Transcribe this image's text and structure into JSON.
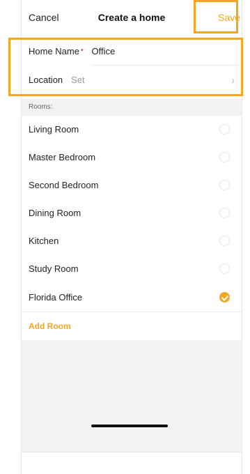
{
  "navbar": {
    "cancel": "Cancel",
    "title": "Create a home",
    "save": "Save"
  },
  "form": {
    "home_name_label": "Home Name",
    "required_mark": "•",
    "home_name_value": "Office",
    "location_label": "Location",
    "location_value": "Set"
  },
  "rooms_caption": "Rooms:",
  "rooms": [
    {
      "name": "Living Room",
      "selected": false
    },
    {
      "name": "Master Bedroom",
      "selected": false
    },
    {
      "name": "Second Bedroom",
      "selected": false
    },
    {
      "name": "Dining Room",
      "selected": false
    },
    {
      "name": "Kitchen",
      "selected": false
    },
    {
      "name": "Study Room",
      "selected": false
    },
    {
      "name": "Florida Office",
      "selected": true
    }
  ],
  "add_room": "Add Room",
  "colors": {
    "accent": "#f5a623",
    "required": "#e53935"
  }
}
